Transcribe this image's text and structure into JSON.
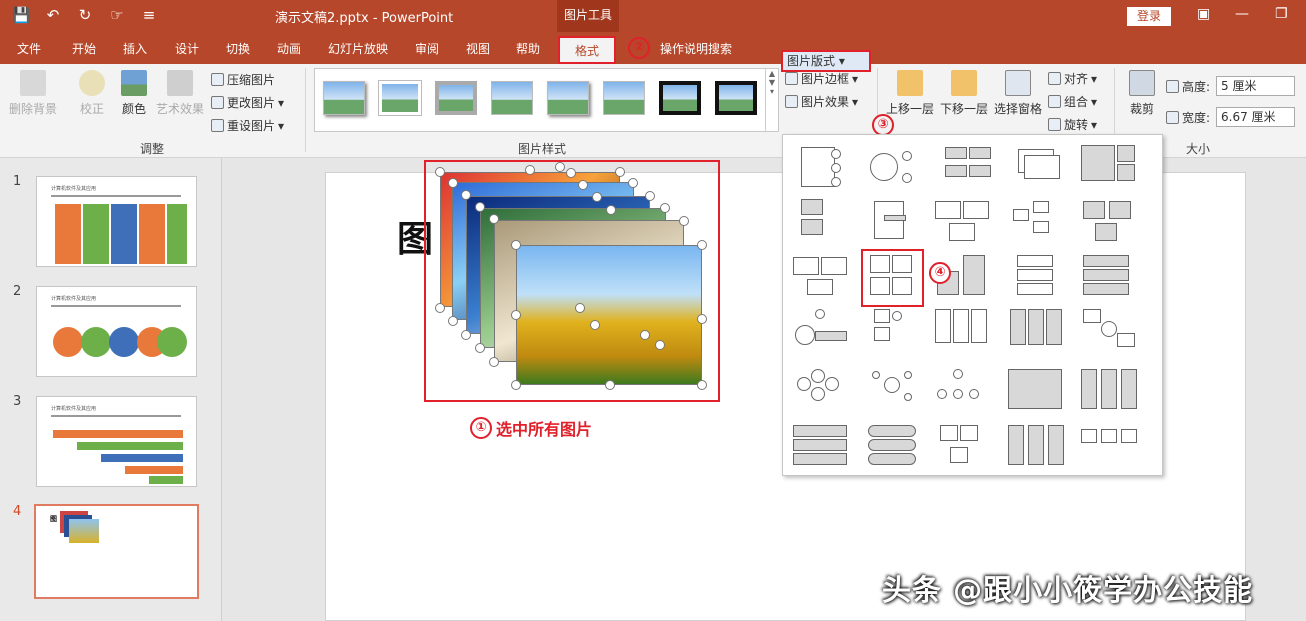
{
  "titlebar": {
    "title": "演示文稿2.pptx  -  PowerPoint",
    "tools_tab": "图片工具",
    "login": "登录"
  },
  "tabs": [
    "文件",
    "开始",
    "插入",
    "设计",
    "切换",
    "动画",
    "幻灯片放映",
    "审阅",
    "视图",
    "帮助"
  ],
  "active_tab": "格式",
  "search_tab": "操作说明搜索",
  "ribbon": {
    "adjust": {
      "remove_bg": "删除背景",
      "correct": "校正",
      "color": "颜色",
      "artistic": "艺术效果",
      "compress": "压缩图片",
      "change": "更改图片",
      "reset": "重设图片",
      "label": "调整"
    },
    "styles": {
      "label": "图片样式"
    },
    "picture_border": "图片边框",
    "picture_effects": "图片效果",
    "picture_layout": "图片版式",
    "arrange": {
      "bring_forward": "上移一层",
      "send_backward": "下移一层",
      "selection_pane": "选择窗格",
      "align": "对齐",
      "group": "组合",
      "rotate": "旋转"
    },
    "size": {
      "crop": "裁剪",
      "height_label": "高度:",
      "height_value": "5 厘米",
      "width_label": "宽度:",
      "width_value": "6.67 厘米",
      "label": "大小"
    }
  },
  "slides": [
    {
      "num": "1",
      "title": "计算机软件及其应用"
    },
    {
      "num": "2",
      "title": "计算机软件及其应用"
    },
    {
      "num": "3",
      "title": "计算机软件及其应用"
    },
    {
      "num": "4",
      "title": "图"
    }
  ],
  "canvas": {
    "slide_text": "图"
  },
  "annotations": {
    "step1": "①",
    "step1_text": "选中所有图片",
    "step2": "②",
    "step3": "③",
    "step4": "④"
  },
  "watermark": "头条 @跟小小筱学办公技能",
  "colors": {
    "accent": "#b7472a",
    "highlight": "#e0202a"
  }
}
